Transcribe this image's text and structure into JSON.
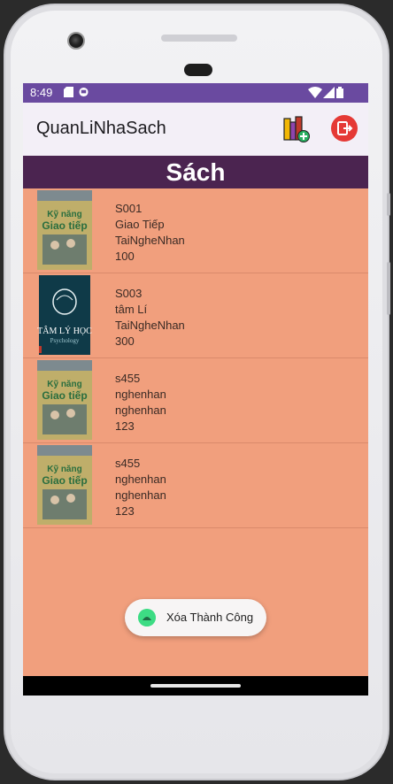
{
  "status_bar": {
    "time": "8:49"
  },
  "app_bar": {
    "title": "QuanLiNhaSach"
  },
  "section_header": {
    "title": "Sách"
  },
  "books": [
    {
      "code": "S001",
      "name": "Giao Tiếp",
      "author": "TaiNgheNhan",
      "quantity": "100",
      "cover": "ky-nang-giao-tiep"
    },
    {
      "code": "S003",
      "name": "tâm Lí",
      "author": "TaiNgheNhan",
      "quantity": "300",
      "cover": "tam-ly-hoc"
    },
    {
      "code": "s455",
      "name": "nghenhan",
      "author": "nghenhan",
      "quantity": "123",
      "cover": "ky-nang-giao-tiep"
    },
    {
      "code": "s455",
      "name": "nghenhan",
      "author": "nghenhan",
      "quantity": "123",
      "cover": "ky-nang-giao-tiep"
    }
  ],
  "toast": {
    "message": "Xóa Thành Công"
  },
  "colors": {
    "status_bar": "#6a4aa0",
    "app_bar": "#f3eff7",
    "header": "#4b2450",
    "list_bg": "#f19f7d"
  }
}
